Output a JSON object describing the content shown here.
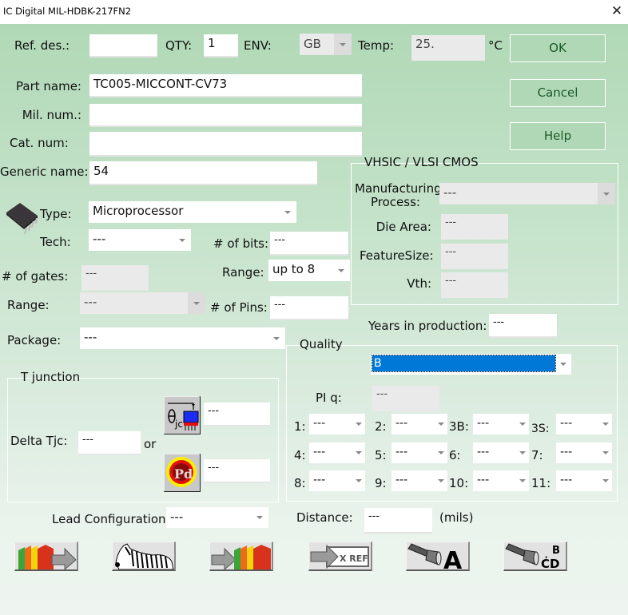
{
  "window": {
    "title": "IC Digital   MIL-HDBK-217FN2",
    "close_glyph": "✕"
  },
  "header": {
    "ref_des_label": "Ref. des.:",
    "ref_des_value": "",
    "qty_label": "QTY:",
    "qty_value": "1",
    "env_label": "ENV:",
    "env_value": "GB",
    "temp_label": "Temp:",
    "temp_value": "25.",
    "temp_unit": "°C"
  },
  "buttons": {
    "ok": "OK",
    "cancel": "Cancel",
    "help": "Help"
  },
  "part": {
    "part_name_label": "Part name:",
    "part_name_value": "TC005-MICCONT-CV73",
    "mil_num_label": "Mil. num.:",
    "mil_num_value": "",
    "cat_num_label": "Cat. num:",
    "cat_num_value": "",
    "generic_name_label": "Generic name:",
    "generic_name_value": "54"
  },
  "device": {
    "type_label": "Type:",
    "type_value": "Microprocessor",
    "tech_label": "Tech:",
    "tech_value": "---",
    "bits_label": "# of bits:",
    "bits_value": "---",
    "gates_label": "# of gates:",
    "gates_value": "---",
    "range_bits_label": "Range:",
    "range_bits_value": "up to 8",
    "range_gates_label": "Range:",
    "range_gates_value": "---",
    "pins_label": "# of Pins:",
    "pins_value": "---",
    "package_label": "Package:",
    "package_value": "---"
  },
  "vhsic": {
    "title": "VHSIC / VLSI CMOS",
    "mfg_label_1": "Manufacturing",
    "mfg_label_2": "Process:",
    "mfg_value": "---",
    "die_area_label": "Die Area:",
    "die_area_value": "---",
    "feature_size_label": "FeatureSize:",
    "feature_size_value": "---",
    "vth_label": "Vth:",
    "vth_value": "---"
  },
  "years": {
    "label": "Years in production:",
    "value": "---"
  },
  "quality": {
    "title": "Quality",
    "value": "B",
    "selected_color": "#0078d7",
    "pi_q_label": "PI q:",
    "pi_q_value": "---",
    "factors": [
      {
        "label": "1:",
        "value": "---"
      },
      {
        "label": "2:",
        "value": "---"
      },
      {
        "label": "3B:",
        "value": "---"
      },
      {
        "label": "3S:",
        "value": "---"
      },
      {
        "label": "4:",
        "value": "---"
      },
      {
        "label": "5:",
        "value": "---"
      },
      {
        "label": "6:",
        "value": "---"
      },
      {
        "label": "7:",
        "value": "---"
      },
      {
        "label": "8:",
        "value": "---"
      },
      {
        "label": "9:",
        "value": "---"
      },
      {
        "label": "10:",
        "value": "---"
      },
      {
        "label": "11:",
        "value": "---"
      }
    ]
  },
  "tjunction": {
    "title": "T junction",
    "delta_label": "Delta Tjc:",
    "delta_value": "---",
    "or_label": "or",
    "theta_jc_value": "---",
    "pd_value": "---",
    "theta_icon": "theta-jc-icon",
    "pd_icon": "power-dissipation-icon"
  },
  "lead": {
    "label": "Lead Configuration:",
    "value": "---",
    "distance_label": "Distance:",
    "distance_value": "---",
    "distance_unit": "(mils)"
  },
  "toolbar": [
    {
      "icon": "books-export-icon"
    },
    {
      "icon": "zebra-icon"
    },
    {
      "icon": "books-import-icon"
    },
    {
      "icon": "cross-reference-icon",
      "text": "X REF"
    },
    {
      "icon": "flashlight-a-icon",
      "text": "A"
    },
    {
      "icon": "flashlight-bcd-icon",
      "text": "BCD"
    }
  ]
}
